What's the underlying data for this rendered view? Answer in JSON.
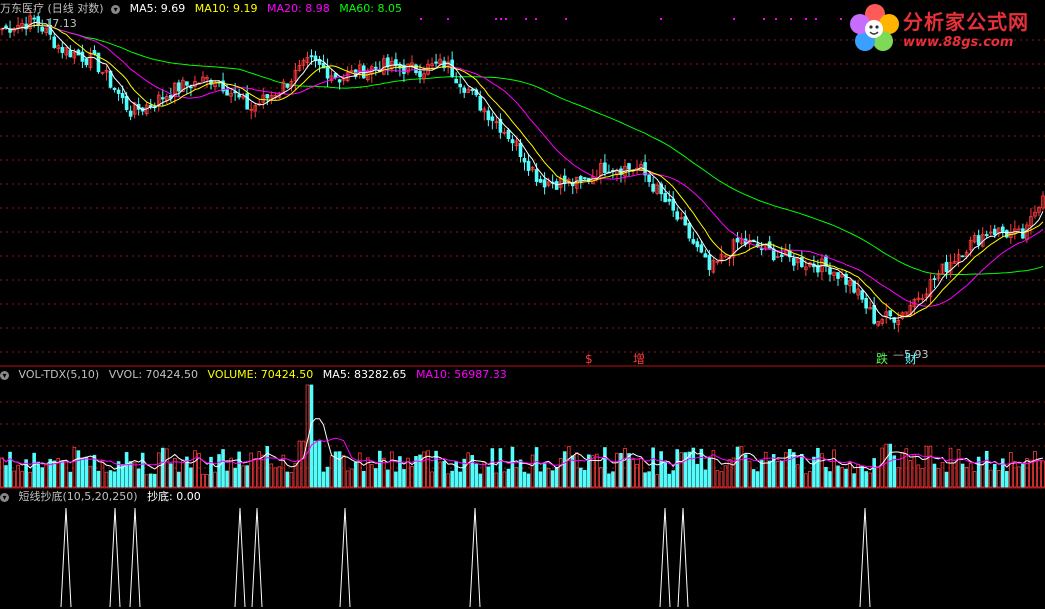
{
  "colors": {
    "up": "#ff3c3c",
    "down": "#54fcfc",
    "ma5": "#ffffff",
    "ma10": "#ffff00",
    "ma20": "#ff00ff",
    "ma60": "#00ff00",
    "label": "#c0c0c0",
    "grid": "#8a1a1a",
    "sep": "#c01010"
  },
  "main": {
    "title": "万东医疗 (日线 对数)",
    "ma5": "MA5: 9.69",
    "ma10": "MA10: 9.19",
    "ma20": "MA20: 8.98",
    "ma60": "MA60: 8.05",
    "high_label": "17.13",
    "low_label": "5.93"
  },
  "markers": {
    "dollar": "$",
    "zeng": "增",
    "die": "跌",
    "cai": "财"
  },
  "volume": {
    "title": "VOL-TDX(5,10)",
    "vvol": "VVOL: 70424.50",
    "volume": "VOLUME: 70424.50",
    "ma5": "MA5: 83282.65",
    "ma10": "MA10: 56987.33"
  },
  "indicator": {
    "title": "短线抄底(10,5,20,250)",
    "value": "抄底: 0.00"
  },
  "watermark": {
    "title": "分析家公式网",
    "url": "www.88gs.com"
  },
  "chart_data": {
    "type": "candlestick",
    "title": "万东医疗 (日线 对数)",
    "price_range": [
      5.93,
      17.13
    ],
    "price_path": [
      [
        0,
        16.5
      ],
      [
        35,
        17.0
      ],
      [
        60,
        15.5
      ],
      [
        95,
        14.8
      ],
      [
        130,
        12.5
      ],
      [
        150,
        12.8
      ],
      [
        180,
        13.6
      ],
      [
        215,
        14.0
      ],
      [
        250,
        12.6
      ],
      [
        280,
        13.5
      ],
      [
        310,
        14.8
      ],
      [
        340,
        14.0
      ],
      [
        380,
        14.6
      ],
      [
        420,
        14.4
      ],
      [
        445,
        14.7
      ],
      [
        480,
        12.8
      ],
      [
        510,
        11.5
      ],
      [
        540,
        9.9
      ],
      [
        580,
        9.8
      ],
      [
        605,
        10.4
      ],
      [
        640,
        10.3
      ],
      [
        680,
        8.6
      ],
      [
        710,
        7.3
      ],
      [
        740,
        8.1
      ],
      [
        790,
        7.6
      ],
      [
        830,
        7.4
      ],
      [
        850,
        7.0
      ],
      [
        875,
        6.2
      ],
      [
        900,
        6.3
      ],
      [
        930,
        7.0
      ],
      [
        960,
        7.8
      ],
      [
        990,
        8.4
      ],
      [
        1025,
        8.2
      ],
      [
        1045,
        9.7
      ]
    ],
    "ma_series": [
      {
        "name": "MA5",
        "value": 9.69
      },
      {
        "name": "MA10",
        "value": 9.19
      },
      {
        "name": "MA20",
        "value": 8.98
      },
      {
        "name": "MA60",
        "value": 8.05
      }
    ],
    "volume_series": [
      {
        "name": "VVOL",
        "value": 70424.5
      },
      {
        "name": "VOLUME",
        "value": 70424.5
      },
      {
        "name": "MA5",
        "value": 83282.65
      },
      {
        "name": "MA10",
        "value": 56987.33
      }
    ],
    "volume_spikes": [
      [
        310,
        1.0
      ],
      [
        888,
        0.42
      ],
      [
        928,
        0.4
      ],
      [
        1035,
        0.35
      ]
    ],
    "indicator_spikes": [
      66,
      115,
      135,
      240,
      257,
      345,
      475,
      665,
      683,
      865
    ],
    "indicator_value": 0.0
  }
}
